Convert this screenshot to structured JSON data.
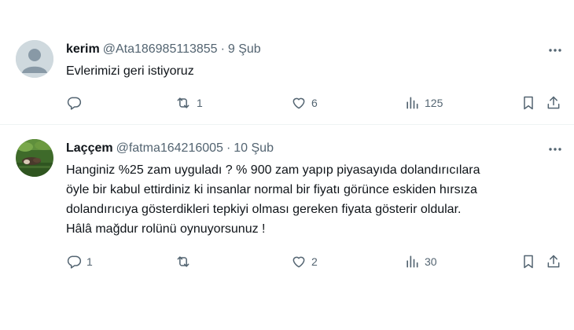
{
  "tweets": [
    {
      "name": "kerim",
      "handle": "@Ata186985113855",
      "separator": "·",
      "date": "9 Şub",
      "text": "Evlerimizi geri istiyoruz",
      "replies": "",
      "retweets": "1",
      "likes": "6",
      "views": "125",
      "avatar": "default-avatar"
    },
    {
      "name": "Laççem",
      "handle": "@fatma164216005",
      "separator": "·",
      "date": "10 Şub",
      "text": "Hanginiz %25 zam uyguladı ? % 900 zam yapıp piyasayıda dolandırıcılara\nöyle bir kabul ettirdiniz ki insanlar normal bir fiyatı görünce eskiden hırsıza\ndolandırıcıya gösterdikleri tepkiyi  olması gereken fiyata gösterir oldular.\nHâlâ mağdur rolünü oynuyorsunuz !",
      "replies": "1",
      "retweets": "",
      "likes": "2",
      "views": "30",
      "avatar": "photo-avatar"
    }
  ],
  "icons": {
    "more": "more-icon",
    "reply": "reply-icon",
    "retweet": "retweet-icon",
    "like": "like-icon",
    "views": "views-icon",
    "bookmark": "bookmark-icon",
    "share": "share-icon"
  },
  "colors": {
    "text": "#0f1419",
    "secondary": "#536471",
    "divider": "#eff3f4",
    "default_avatar_bg": "#cfd9de"
  }
}
